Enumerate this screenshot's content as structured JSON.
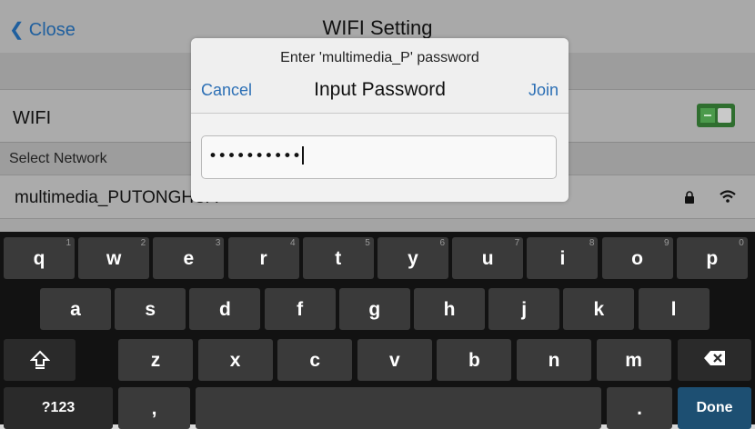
{
  "nav": {
    "back_label": "Close",
    "title": "WIFI Setting"
  },
  "wifi_row": {
    "label": "WIFI",
    "toggle_on": true
  },
  "section": {
    "label": "Select Network"
  },
  "networks": [
    {
      "name": "multimedia_PUTONGHUA",
      "locked": true,
      "icons": [
        "lock-icon",
        "wifi-icon"
      ]
    }
  ],
  "dialog": {
    "prompt": "Enter 'multimedia_P' password",
    "cancel_label": "Cancel",
    "title": "Input Password",
    "join_label": "Join",
    "password_masked": "••••••••••"
  },
  "keyboard": {
    "row1": [
      {
        "k": "q",
        "h": "1"
      },
      {
        "k": "w",
        "h": "2"
      },
      {
        "k": "e",
        "h": "3"
      },
      {
        "k": "r",
        "h": "4"
      },
      {
        "k": "t",
        "h": "5"
      },
      {
        "k": "y",
        "h": "6"
      },
      {
        "k": "u",
        "h": "7"
      },
      {
        "k": "i",
        "h": "8"
      },
      {
        "k": "o",
        "h": "9"
      },
      {
        "k": "p",
        "h": "0"
      }
    ],
    "row2": [
      "a",
      "s",
      "d",
      "f",
      "g",
      "h",
      "j",
      "k",
      "l"
    ],
    "row3": [
      "z",
      "x",
      "c",
      "v",
      "b",
      "n",
      "m"
    ],
    "sym_label": "?123",
    "comma": ",",
    "period": ".",
    "done_label": "Done"
  },
  "colors": {
    "accent": "#2c6fb5",
    "toggle_on": "#2f6e2f",
    "done_key": "#1d4f72"
  }
}
